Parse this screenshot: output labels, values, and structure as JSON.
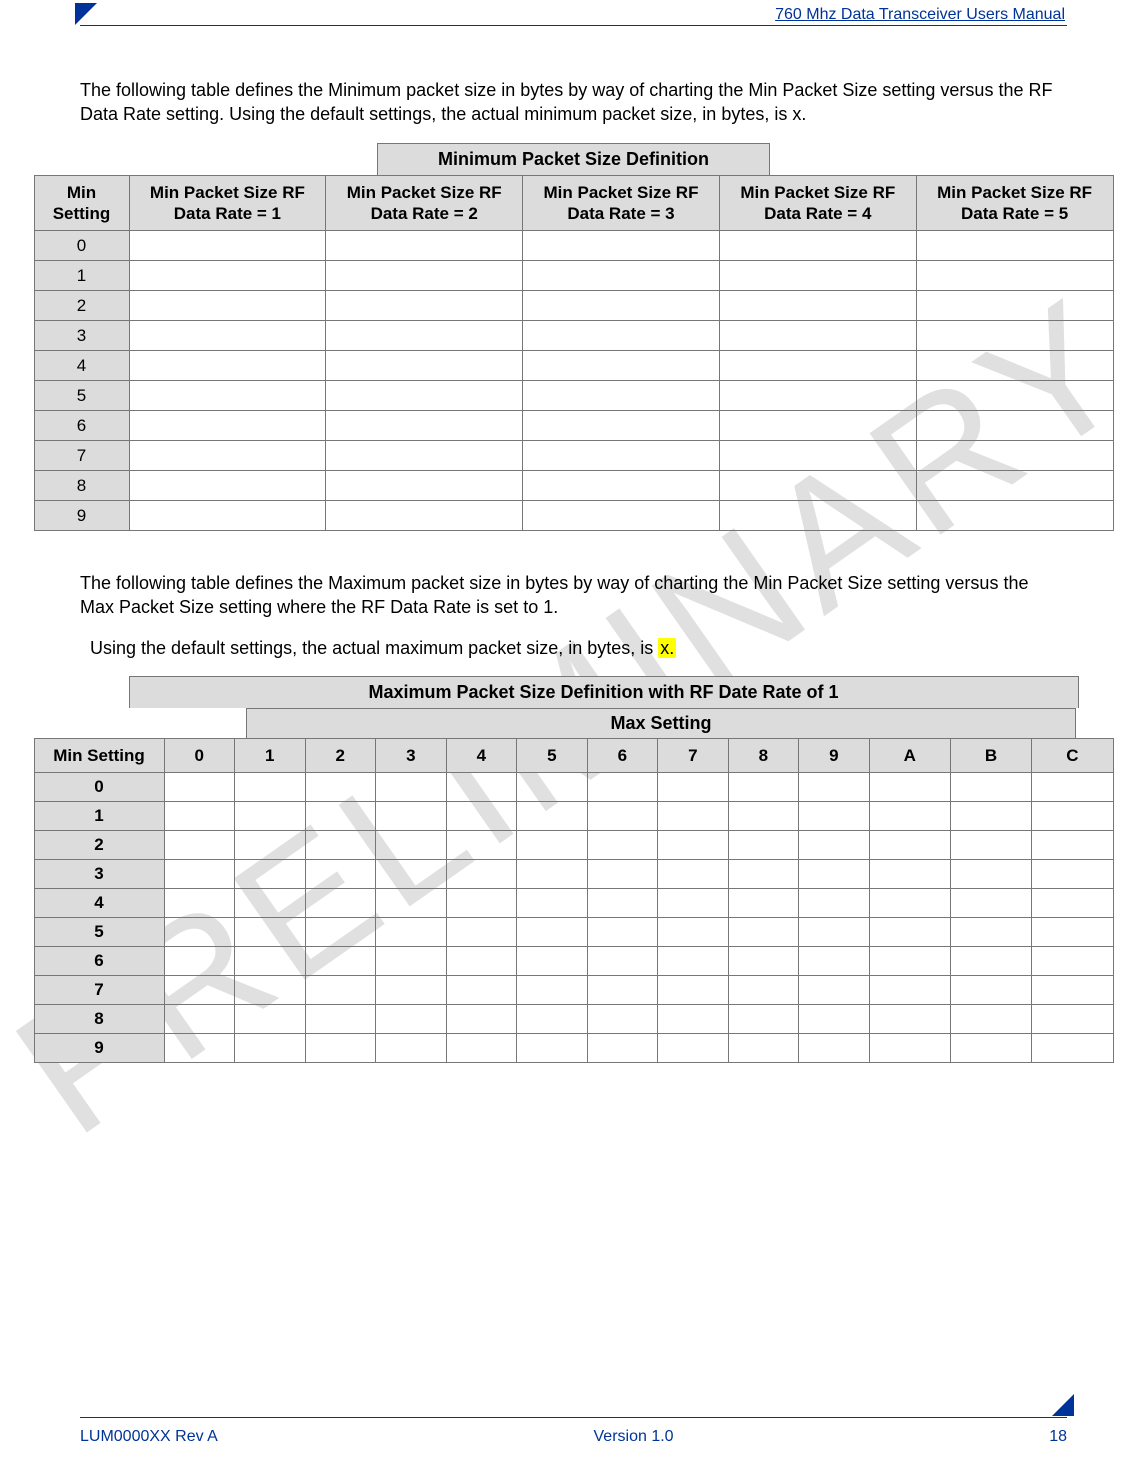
{
  "header": {
    "title": "760 Mhz Data Transceiver Users Manual"
  },
  "watermark": "PRELIMINARY",
  "paragraphs": {
    "p1": "The following table defines the Minimum packet size in bytes by way of charting the Min Packet Size setting versus the RF Data Rate setting. Using the default settings, the actual minimum packet size, in bytes, is x.",
    "p2": "The following table defines the Maximum packet size in bytes by way of charting the Min Packet Size setting versus the Max Packet Size setting where the RF Data Rate is set to 1.",
    "p3_prefix": "Using the default settings, the actual maximum packet size, in bytes, is ",
    "p3_highlight": "x."
  },
  "table1": {
    "caption": "Minimum Packet Size Definition",
    "col_min_setting": "Min Setting",
    "col_headers": [
      "Min Packet Size RF Data Rate = 1",
      "Min Packet Size RF Data Rate = 2",
      "Min Packet Size RF Data Rate = 3",
      "Min Packet Size RF Data Rate = 4",
      "Min Packet Size RF Data Rate = 5"
    ],
    "rows": [
      "0",
      "1",
      "2",
      "3",
      "4",
      "5",
      "6",
      "7",
      "8",
      "9"
    ]
  },
  "table2": {
    "caption": "Maximum Packet Size Definition with RF Date Rate of 1",
    "subcaption": "Max Setting",
    "col_min_setting": "Min Setting",
    "max_cols": [
      "0",
      "1",
      "2",
      "3",
      "4",
      "5",
      "6",
      "7",
      "8",
      "9",
      "A",
      "B",
      "C"
    ],
    "rows": [
      "0",
      "1",
      "2",
      "3",
      "4",
      "5",
      "6",
      "7",
      "8",
      "9"
    ]
  },
  "footer": {
    "left": "LUM0000XX Rev A",
    "center": "Version 1.0",
    "right": "18"
  }
}
